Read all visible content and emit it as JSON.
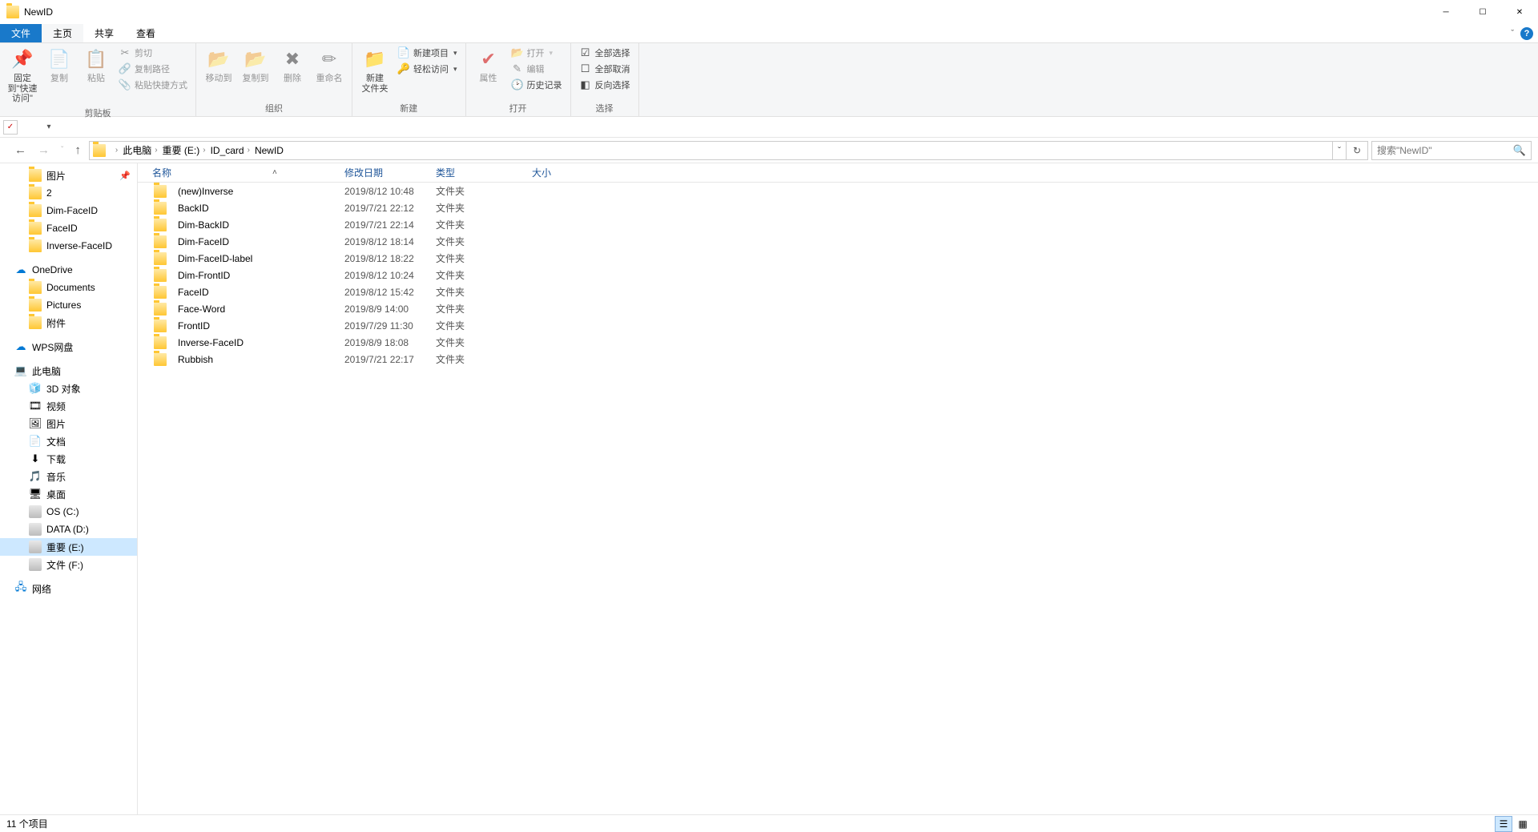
{
  "window": {
    "title": "NewID"
  },
  "tabs": {
    "file": "文件",
    "home": "主页",
    "share": "共享",
    "view": "查看"
  },
  "ribbon": {
    "clipboard": {
      "pin": "固定到\"快速访问\"",
      "copy": "复制",
      "paste": "粘贴",
      "cut": "剪切",
      "copypath": "复制路径",
      "pasteshortcut": "粘贴快捷方式",
      "label": "剪贴板"
    },
    "organize": {
      "moveto": "移动到",
      "copyto": "复制到",
      "delete": "删除",
      "rename": "重命名",
      "label": "组织"
    },
    "new": {
      "newfolder": "新建\n文件夹",
      "newitem": "新建项目",
      "easyaccess": "轻松访问",
      "label": "新建"
    },
    "open": {
      "properties": "属性",
      "open": "打开",
      "edit": "编辑",
      "history": "历史记录",
      "label": "打开"
    },
    "select": {
      "selectall": "全部选择",
      "selectnone": "全部取消",
      "invert": "反向选择",
      "label": "选择"
    }
  },
  "breadcrumb": {
    "pc": "此电脑",
    "drive": "重要 (E:)",
    "folder1": "ID_card",
    "folder2": "NewID"
  },
  "search": {
    "placeholder": "搜索\"NewID\""
  },
  "columns": {
    "name": "名称",
    "date": "修改日期",
    "type": "类型",
    "size": "大小"
  },
  "navtree": {
    "pictures": "图片",
    "two": "2",
    "dimfaceid": "Dim-FaceID",
    "faceid": "FaceID",
    "inversefaceid": "Inverse-FaceID",
    "onedrive": "OneDrive",
    "documents": "Documents",
    "pictures2": "Pictures",
    "attach": "附件",
    "wps": "WPS网盘",
    "thispc": "此电脑",
    "obj3d": "3D 对象",
    "videos": "视频",
    "pics": "图片",
    "docs": "文档",
    "downloads": "下载",
    "music": "音乐",
    "desktop": "桌面",
    "osc": "OS (C:)",
    "datad": "DATA (D:)",
    "impe": "重要 (E:)",
    "filef": "文件 (F:)",
    "network": "网络"
  },
  "files": [
    {
      "name": "(new)Inverse",
      "date": "2019/8/12 10:48",
      "type": "文件夹",
      "size": ""
    },
    {
      "name": "BackID",
      "date": "2019/7/21 22:12",
      "type": "文件夹",
      "size": ""
    },
    {
      "name": "Dim-BackID",
      "date": "2019/7/21 22:14",
      "type": "文件夹",
      "size": ""
    },
    {
      "name": "Dim-FaceID",
      "date": "2019/8/12 18:14",
      "type": "文件夹",
      "size": ""
    },
    {
      "name": "Dim-FaceID-label",
      "date": "2019/8/12 18:22",
      "type": "文件夹",
      "size": ""
    },
    {
      "name": "Dim-FrontID",
      "date": "2019/8/12 10:24",
      "type": "文件夹",
      "size": ""
    },
    {
      "name": "FaceID",
      "date": "2019/8/12 15:42",
      "type": "文件夹",
      "size": ""
    },
    {
      "name": "Face-Word",
      "date": "2019/8/9 14:00",
      "type": "文件夹",
      "size": ""
    },
    {
      "name": "FrontID",
      "date": "2019/7/29 11:30",
      "type": "文件夹",
      "size": ""
    },
    {
      "name": "Inverse-FaceID",
      "date": "2019/8/9 18:08",
      "type": "文件夹",
      "size": ""
    },
    {
      "name": "Rubbish",
      "date": "2019/7/21 22:17",
      "type": "文件夹",
      "size": ""
    }
  ],
  "status": {
    "count": "11 个项目"
  }
}
